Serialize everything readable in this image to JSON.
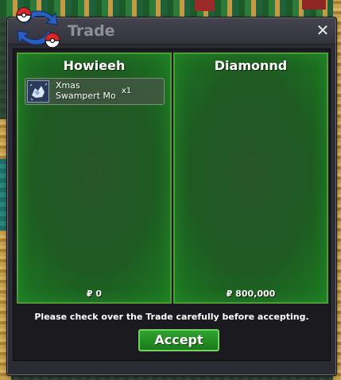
{
  "window": {
    "title": "Trade",
    "close_label": "✕"
  },
  "left_panel": {
    "player_name": "Howieeh",
    "items": [
      {
        "name": "Xmas\nSwampert Mo",
        "quantity": "x1",
        "icon": "swampert-sprite-icon"
      }
    ],
    "money": "₽ 0"
  },
  "right_panel": {
    "player_name": "Diamonnd",
    "items": [],
    "money": "₽ 800,000"
  },
  "instruction": "Please check over the Trade carefully before accepting.",
  "accept_label": "Accept",
  "colors": {
    "panel_border": "#4f9a3c",
    "panel_fill": "#1e5a22",
    "window_bg": "#2b2b33",
    "accept_bg": "#1f8a1f"
  }
}
